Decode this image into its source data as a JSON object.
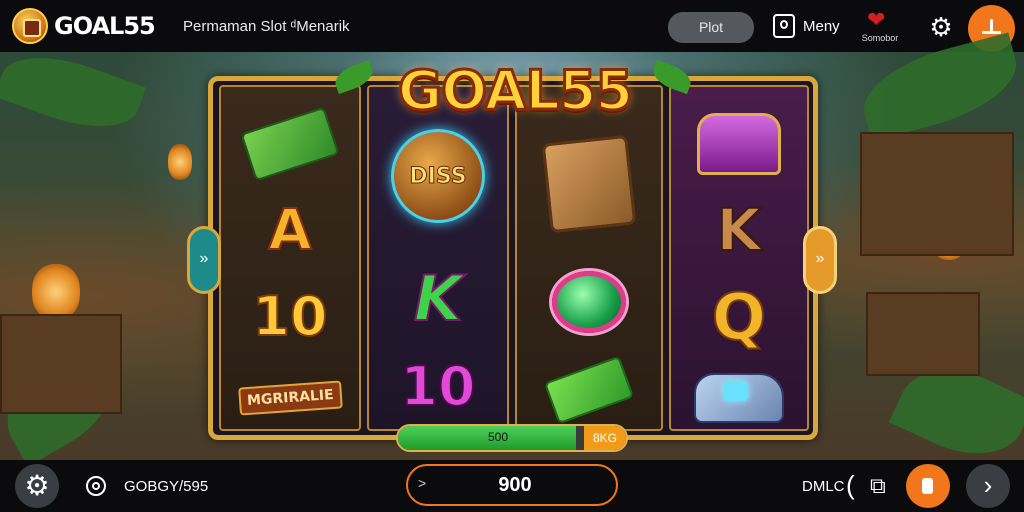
{
  "header": {
    "brand": "GOAL55",
    "tagline": "Permaman Slot ᵈMenarik",
    "plot_button": "Plot",
    "menu_label": "Meny",
    "heart_label": "Somobor"
  },
  "game": {
    "logo_text": "GOAL55",
    "reels": [
      [
        "cash-stack",
        "A",
        "10",
        "MGRIRALIE"
      ],
      [
        "DISS",
        "K",
        "10"
      ],
      [
        "totem",
        "gem",
        "green-cash"
      ],
      [
        "purple-chest",
        "K",
        "Q",
        "cart"
      ]
    ],
    "symbol_texts": {
      "reel1_a": "A",
      "reel1_10": "10",
      "reel1_sign": "MGRIRALIE",
      "reel2_disc": "DISS",
      "reel2_k": "K",
      "reel2_10": "10",
      "reel4_k": "K",
      "reel4_q": "Q"
    },
    "left_arrow_glyph": "»",
    "right_arrow_glyph": "»",
    "progress": {
      "label": "500",
      "tail": "8KG",
      "fill_fraction": 0.78
    }
  },
  "footer": {
    "balance_label": "GOBGY/595",
    "bet_chevron": ">",
    "bet_value": "900",
    "mode_label": "DMLC"
  },
  "icons": {
    "logo": "mascot-logo-icon",
    "menu": "phone-menu-icon",
    "heart": "heart-icon",
    "settings_top": "gear-icon",
    "account": "account-icon",
    "settings_bottom": "gear-icon",
    "target": "target-icon",
    "share": "share-icon",
    "spin": "spin-icon",
    "next": "chevron-right-icon"
  },
  "colors": {
    "accent": "#f2761b",
    "frame_gold": "#d9a73a",
    "progress_green": "#4fd05a",
    "bar_bg": "#0b0b0d"
  }
}
